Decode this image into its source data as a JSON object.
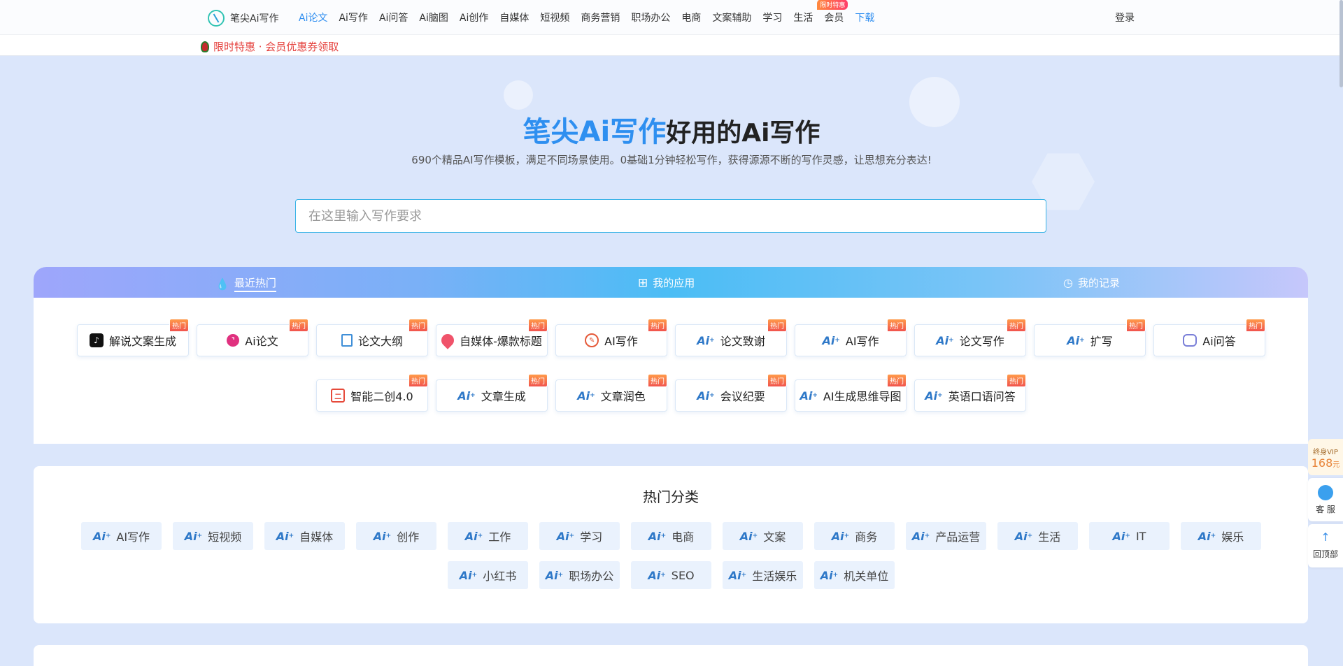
{
  "topnav": {
    "logo_text": "笔尖Ai写作",
    "items": [
      "Ai论文",
      "Ai写作",
      "Ai问答",
      "Ai脑图",
      "Ai创作",
      "自媒体",
      "短视频",
      "商务营销",
      "职场办公",
      "电商",
      "文案辅助",
      "学习",
      "生活"
    ],
    "vip_label": "会员",
    "vip_badge": "限时特惠",
    "download_label": "下载",
    "login_label": "登录"
  },
  "promo": {
    "text": "限时特惠 · 会员优惠券领取"
  },
  "hero": {
    "title_brand": "笔尖Ai写作",
    "title_rest": "好用的Ai写作",
    "subtitle": "690个精品AI写作模板，满足不同场景使用。0基础1分钟轻松写作，获得源源不断的写作灵感，让思想充分表达!",
    "search_placeholder": "在这里输入写作要求"
  },
  "tabs": {
    "hot": "最近热门",
    "apps": "我的应用",
    "history": "我的记录"
  },
  "hot_label": "热门",
  "hot_items": [
    {
      "label": "解说文案生成",
      "icon": "tiktok-icon"
    },
    {
      "label": "Ai论文",
      "icon": "paper-icon"
    },
    {
      "label": "论文大纲",
      "icon": "document-icon"
    },
    {
      "label": "自媒体-爆款标题",
      "icon": "tag-icon"
    },
    {
      "label": "AI写作",
      "icon": "write-icon"
    },
    {
      "label": "论文致谢",
      "icon": "ai-icon"
    },
    {
      "label": "AI写作",
      "icon": "ai-icon"
    },
    {
      "label": "论文写作",
      "icon": "ai-icon"
    },
    {
      "label": "扩写",
      "icon": "ai-icon"
    },
    {
      "label": "Ai问答",
      "icon": "robot-icon"
    },
    {
      "label": "智能二创4.0",
      "icon": "smart-icon"
    },
    {
      "label": "文章生成",
      "icon": "ai-icon"
    },
    {
      "label": "文章润色",
      "icon": "ai-icon"
    },
    {
      "label": "会议纪要",
      "icon": "ai-icon"
    },
    {
      "label": "AI生成思维导图",
      "icon": "ai-icon"
    },
    {
      "label": "英语口语问答",
      "icon": "ai-icon"
    }
  ],
  "categories": {
    "title": "热门分类",
    "items": [
      "AI写作",
      "短视频",
      "自媒体",
      "创作",
      "工作",
      "学习",
      "电商",
      "文案",
      "商务",
      "产品运营",
      "生活",
      "IT",
      "娱乐",
      "小红书",
      "职场办公",
      "SEO",
      "生活娱乐",
      "机关单位"
    ]
  },
  "float": {
    "vip_title": "终身VIP",
    "vip_price": "168",
    "vip_unit": "元",
    "service": "客 服",
    "top": "回顶部"
  },
  "colors": {
    "brand": "#2e8ff0",
    "hot_badge": "#f1544e",
    "promo": "#e5413d"
  }
}
